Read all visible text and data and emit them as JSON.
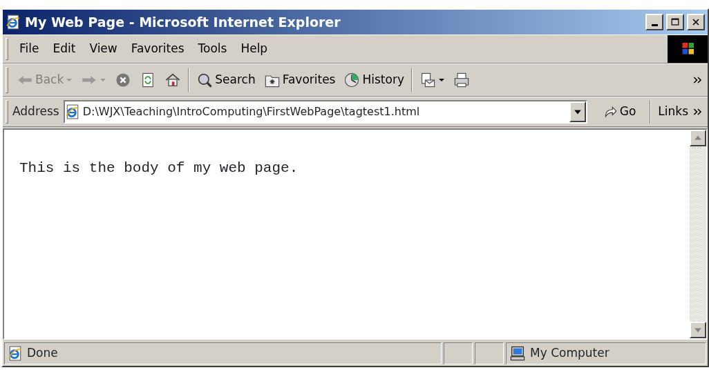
{
  "window": {
    "title": "My Web Page - Microsoft Internet Explorer"
  },
  "menu": [
    {
      "label": "File"
    },
    {
      "label": "Edit"
    },
    {
      "label": "View"
    },
    {
      "label": "Favorites"
    },
    {
      "label": "Tools"
    },
    {
      "label": "Help"
    }
  ],
  "toolbar": [
    {
      "kind": "back",
      "label": "Back",
      "disabled": true
    },
    {
      "kind": "forward",
      "disabled": true
    },
    {
      "kind": "stop"
    },
    {
      "kind": "refresh"
    },
    {
      "kind": "home"
    },
    {
      "kind": "separator"
    },
    {
      "kind": "search",
      "label": "Search"
    },
    {
      "kind": "favorites",
      "label": "Favorites"
    },
    {
      "kind": "history",
      "label": "History"
    },
    {
      "kind": "separator"
    },
    {
      "kind": "mail"
    },
    {
      "kind": "print"
    }
  ],
  "address": {
    "label": "Address",
    "value": "D:\\WJX\\Teaching\\IntroComputing\\FirstWebPage\\tagtest1.html",
    "go": "Go",
    "links": "Links"
  },
  "page": {
    "body": "This is the body of my web page."
  },
  "status_bar": {
    "text": "Done",
    "zone": "My Computer"
  }
}
